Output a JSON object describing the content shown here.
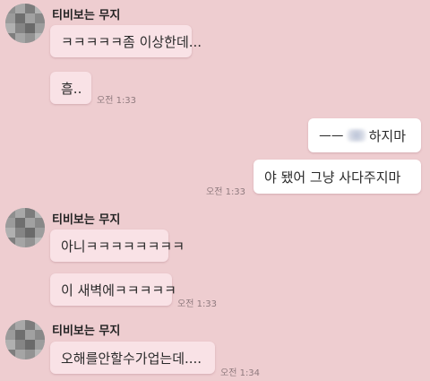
{
  "colors": {
    "background": "#eecdd0",
    "incoming_bubble": "#f9e2e6",
    "outgoing_bubble": "#ffffff",
    "time_text": "#8f7a7e"
  },
  "groups": [
    {
      "sender": "티비보는 무지",
      "messages": [
        "ㅋㅋㅋㅋㅋ좀 이상한데...",
        "흠.."
      ],
      "time": "오전 1:33"
    },
    {
      "sender": "티비보는 무지",
      "messages": [
        "아니ㅋㅋㅋㅋㅋㅋㅋㅋ",
        "이 새벽에ㅋㅋㅋㅋㅋ"
      ],
      "time": "오전 1:33"
    },
    {
      "sender": "티비보는 무지",
      "messages": [
        "오해를안할수가업는데...."
      ],
      "time": "오전 1:34"
    }
  ],
  "outgoing": {
    "messages": [
      {
        "prefix": "ㅡㅡ",
        "suffix": "하지마"
      },
      {
        "text": "야 됐어 그냥 사다주지마"
      }
    ],
    "time": "오전 1:33"
  }
}
